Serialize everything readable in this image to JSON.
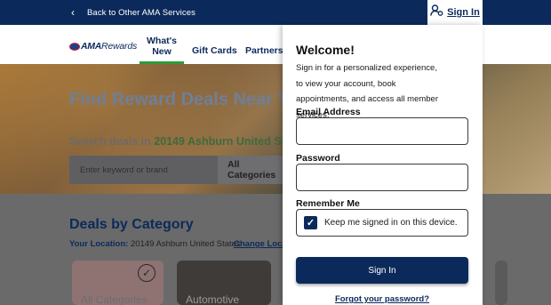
{
  "topbar": {
    "back_label": "Back to Other AMA Services",
    "signin_label": "Sign In"
  },
  "nav": {
    "logo_ama": "AMA",
    "logo_rewards": "Rewards",
    "items": [
      {
        "label": "What's New",
        "active": true
      },
      {
        "label": "Gift Cards",
        "active": false
      },
      {
        "label": "Partners",
        "active": false
      }
    ]
  },
  "hero": {
    "title": "Find Reward Deals Near You",
    "search_prefix": "Search deals in",
    "search_location": "20149 Ashburn United States",
    "search_placeholder": "Enter keyword or brand",
    "category_value": "All Categories"
  },
  "deals": {
    "title": "Deals by Category",
    "location_label": "Your Location:",
    "location_value": "20149 Ashburn United States",
    "change_location": "Change Location",
    "cards": [
      {
        "label": "All Categories",
        "selected": true
      },
      {
        "label": "Automotive",
        "selected": false
      }
    ]
  },
  "signin_panel": {
    "title": "Welcome!",
    "description": "Sign in for a personalized experience, to view your account, book appointments, and access all member services.",
    "email_label": "Email Address",
    "email_value": "",
    "password_label": "Password",
    "password_value": "",
    "remember_label": "Remember Me",
    "remember_text": "Keep me signed in on this device.",
    "remember_checked": true,
    "signin_button": "Sign In",
    "forgot_link": "Forgot your password?"
  },
  "colors": {
    "navy": "#0b2a5b",
    "green_accent": "#2f9a3a"
  },
  "icons": {
    "back": "chevron-left-icon",
    "user": "user-settings-icon",
    "check": "check-icon"
  }
}
